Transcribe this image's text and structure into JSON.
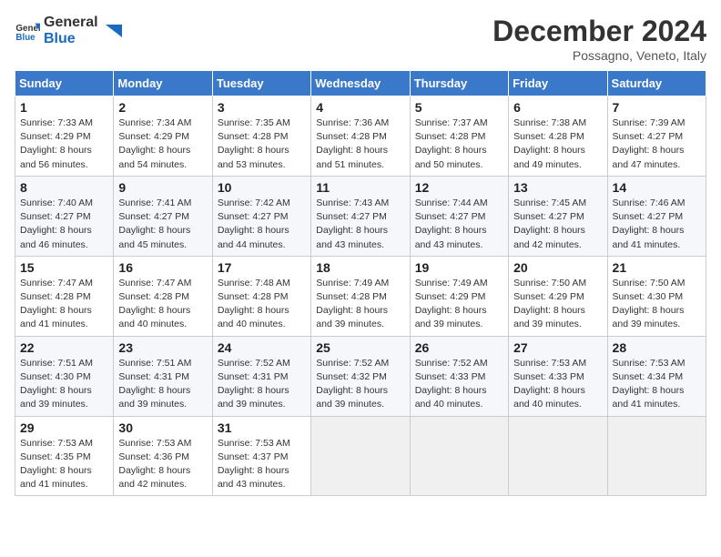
{
  "header": {
    "logo_line1": "General",
    "logo_line2": "Blue",
    "month_title": "December 2024",
    "location": "Possagno, Veneto, Italy"
  },
  "days_of_week": [
    "Sunday",
    "Monday",
    "Tuesday",
    "Wednesday",
    "Thursday",
    "Friday",
    "Saturday"
  ],
  "weeks": [
    [
      {
        "day": 1,
        "sunrise": "7:33 AM",
        "sunset": "4:29 PM",
        "daylight": "8 hours and 56 minutes."
      },
      {
        "day": 2,
        "sunrise": "7:34 AM",
        "sunset": "4:29 PM",
        "daylight": "8 hours and 54 minutes."
      },
      {
        "day": 3,
        "sunrise": "7:35 AM",
        "sunset": "4:28 PM",
        "daylight": "8 hours and 53 minutes."
      },
      {
        "day": 4,
        "sunrise": "7:36 AM",
        "sunset": "4:28 PM",
        "daylight": "8 hours and 51 minutes."
      },
      {
        "day": 5,
        "sunrise": "7:37 AM",
        "sunset": "4:28 PM",
        "daylight": "8 hours and 50 minutes."
      },
      {
        "day": 6,
        "sunrise": "7:38 AM",
        "sunset": "4:28 PM",
        "daylight": "8 hours and 49 minutes."
      },
      {
        "day": 7,
        "sunrise": "7:39 AM",
        "sunset": "4:27 PM",
        "daylight": "8 hours and 47 minutes."
      }
    ],
    [
      {
        "day": 8,
        "sunrise": "7:40 AM",
        "sunset": "4:27 PM",
        "daylight": "8 hours and 46 minutes."
      },
      {
        "day": 9,
        "sunrise": "7:41 AM",
        "sunset": "4:27 PM",
        "daylight": "8 hours and 45 minutes."
      },
      {
        "day": 10,
        "sunrise": "7:42 AM",
        "sunset": "4:27 PM",
        "daylight": "8 hours and 44 minutes."
      },
      {
        "day": 11,
        "sunrise": "7:43 AM",
        "sunset": "4:27 PM",
        "daylight": "8 hours and 43 minutes."
      },
      {
        "day": 12,
        "sunrise": "7:44 AM",
        "sunset": "4:27 PM",
        "daylight": "8 hours and 43 minutes."
      },
      {
        "day": 13,
        "sunrise": "7:45 AM",
        "sunset": "4:27 PM",
        "daylight": "8 hours and 42 minutes."
      },
      {
        "day": 14,
        "sunrise": "7:46 AM",
        "sunset": "4:27 PM",
        "daylight": "8 hours and 41 minutes."
      }
    ],
    [
      {
        "day": 15,
        "sunrise": "7:47 AM",
        "sunset": "4:28 PM",
        "daylight": "8 hours and 41 minutes."
      },
      {
        "day": 16,
        "sunrise": "7:47 AM",
        "sunset": "4:28 PM",
        "daylight": "8 hours and 40 minutes."
      },
      {
        "day": 17,
        "sunrise": "7:48 AM",
        "sunset": "4:28 PM",
        "daylight": "8 hours and 40 minutes."
      },
      {
        "day": 18,
        "sunrise": "7:49 AM",
        "sunset": "4:28 PM",
        "daylight": "8 hours and 39 minutes."
      },
      {
        "day": 19,
        "sunrise": "7:49 AM",
        "sunset": "4:29 PM",
        "daylight": "8 hours and 39 minutes."
      },
      {
        "day": 20,
        "sunrise": "7:50 AM",
        "sunset": "4:29 PM",
        "daylight": "8 hours and 39 minutes."
      },
      {
        "day": 21,
        "sunrise": "7:50 AM",
        "sunset": "4:30 PM",
        "daylight": "8 hours and 39 minutes."
      }
    ],
    [
      {
        "day": 22,
        "sunrise": "7:51 AM",
        "sunset": "4:30 PM",
        "daylight": "8 hours and 39 minutes."
      },
      {
        "day": 23,
        "sunrise": "7:51 AM",
        "sunset": "4:31 PM",
        "daylight": "8 hours and 39 minutes."
      },
      {
        "day": 24,
        "sunrise": "7:52 AM",
        "sunset": "4:31 PM",
        "daylight": "8 hours and 39 minutes."
      },
      {
        "day": 25,
        "sunrise": "7:52 AM",
        "sunset": "4:32 PM",
        "daylight": "8 hours and 39 minutes."
      },
      {
        "day": 26,
        "sunrise": "7:52 AM",
        "sunset": "4:33 PM",
        "daylight": "8 hours and 40 minutes."
      },
      {
        "day": 27,
        "sunrise": "7:53 AM",
        "sunset": "4:33 PM",
        "daylight": "8 hours and 40 minutes."
      },
      {
        "day": 28,
        "sunrise": "7:53 AM",
        "sunset": "4:34 PM",
        "daylight": "8 hours and 41 minutes."
      }
    ],
    [
      {
        "day": 29,
        "sunrise": "7:53 AM",
        "sunset": "4:35 PM",
        "daylight": "8 hours and 41 minutes."
      },
      {
        "day": 30,
        "sunrise": "7:53 AM",
        "sunset": "4:36 PM",
        "daylight": "8 hours and 42 minutes."
      },
      {
        "day": 31,
        "sunrise": "7:53 AM",
        "sunset": "4:37 PM",
        "daylight": "8 hours and 43 minutes."
      },
      null,
      null,
      null,
      null
    ]
  ],
  "labels": {
    "sunrise": "Sunrise:",
    "sunset": "Sunset:",
    "daylight": "Daylight:"
  }
}
